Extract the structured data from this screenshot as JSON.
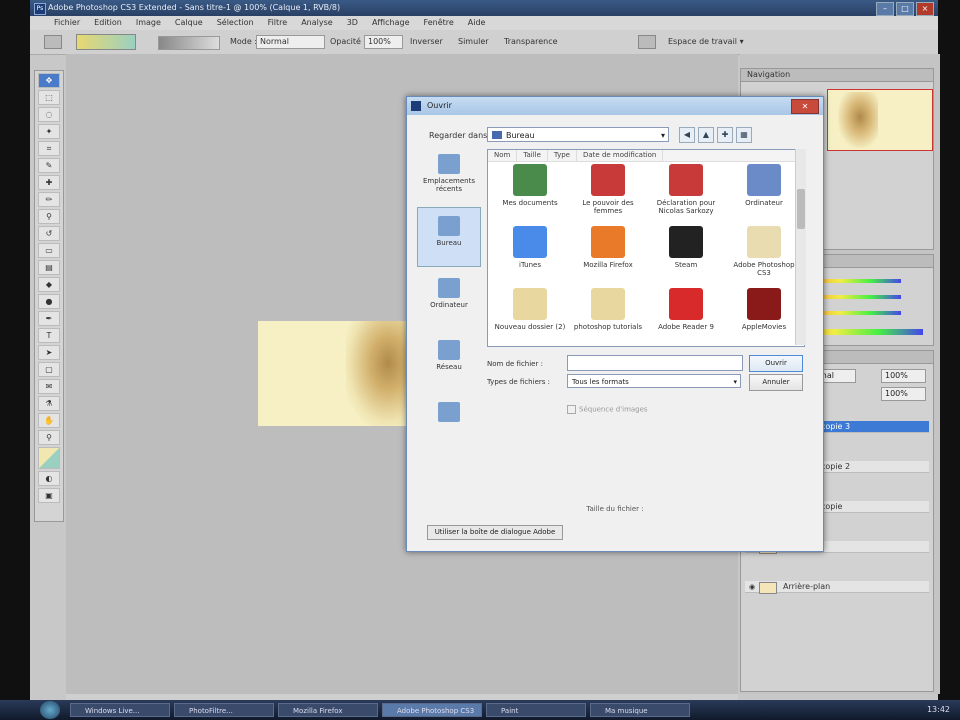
{
  "app": {
    "title": "Adobe Photoshop CS3 Extended - Sans titre-1 @ 100% (Calque 1, RVB/8)",
    "logo": "Ps"
  },
  "menubar": [
    "Fichier",
    "Edition",
    "Image",
    "Calque",
    "Sélection",
    "Filtre",
    "Analyse",
    "3D",
    "Affichage",
    "Fenêtre",
    "Aide"
  ],
  "optionsbar": {
    "mode_label": "Mode :",
    "mode_value": "Normal",
    "opacity_label": "Opacité :",
    "opacity_value": "100%",
    "inverse": "Inverser",
    "simulate": "Simuler",
    "transparency": "Transparence",
    "workspace": "Espace de travail ▾"
  },
  "dialog": {
    "title": "Ouvrir",
    "lookin_label": "Regarder dans :",
    "lookin_value": "Bureau",
    "columns": [
      "Nom",
      "Taille",
      "Type",
      "Date de modification"
    ],
    "places": [
      {
        "label": "Emplacements récents"
      },
      {
        "label": "Bureau"
      },
      {
        "label": "Ordinateur"
      },
      {
        "label": "Réseau"
      },
      {
        "label": ""
      }
    ],
    "files": [
      {
        "name": "Mes documents",
        "color": "#4a8a4a"
      },
      {
        "name": "Le pouvoir des femmes",
        "color": "#c83a3a"
      },
      {
        "name": "Déclaration pour Nicolas Sarkozy",
        "color": "#c83a3a"
      },
      {
        "name": "Ordinateur",
        "color": "#6a8ac8"
      },
      {
        "name": "iTunes",
        "color": "#4a8ae8"
      },
      {
        "name": "Mozilla Firefox",
        "color": "#e87a2a"
      },
      {
        "name": "Steam",
        "color": "#222222"
      },
      {
        "name": "Adobe Photoshop CS3",
        "color": "#e8dcb0"
      },
      {
        "name": "Nouveau dossier (2)",
        "color": "#e8d8a0"
      },
      {
        "name": "photoshop tutorials",
        "color": "#e8d8a0"
      },
      {
        "name": "Adobe Reader 9",
        "color": "#d82a2a"
      },
      {
        "name": "AppleMovies",
        "color": "#8a1a1a"
      }
    ],
    "filename_label": "Nom de fichier :",
    "filename_value": "",
    "filetype_label": "Types de fichiers :",
    "filetype_value": "Tous les formats",
    "open_button": "Ouvrir",
    "cancel_button": "Annuler",
    "sequence_label": "Séquence d'images",
    "file_size_label": "Taille du fichier :",
    "bottom_button": "Utiliser la boîte de dialogue Adobe"
  },
  "panels": {
    "navigator_tab": "Navigation",
    "info_tab": "Histogramme",
    "color_tab": "Couleur",
    "swatches_tab": "Nuancier",
    "layers_tab": "Calques",
    "blend_mode": "Normal",
    "opacity_value": "100%",
    "fill_value": "100%",
    "layers": [
      {
        "name": "Calque 1 copie 3",
        "active": true
      },
      {
        "name": "Calque 1 copie 2",
        "active": false
      },
      {
        "name": "Calque 1 copie",
        "active": false
      },
      {
        "name": "Calque 1",
        "active": false
      },
      {
        "name": "Arrière-plan",
        "active": false
      }
    ]
  },
  "taskbar": {
    "tasks": [
      "Windows Live...",
      "PhotoFiltre...",
      "Mozilla Firefox",
      "Adobe Photoshop CS3",
      "Paint",
      "Ma musique"
    ],
    "active_task": "Adobe Photoshop CS3",
    "clock": "13:42"
  },
  "colors": {
    "accent": "#3d7ad6",
    "canvas_bg": "#bdbdbd",
    "image_bg": "#f6f0c4"
  }
}
